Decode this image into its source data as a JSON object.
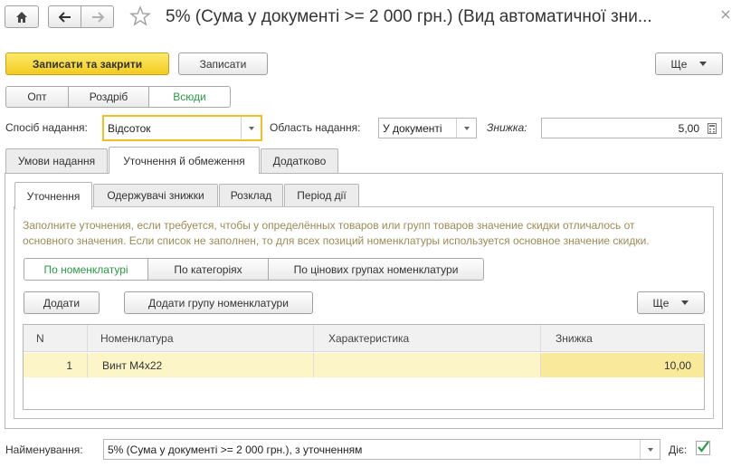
{
  "window": {
    "title": "5% (Сума у документі >= 2 000 грн.) (Вид автоматичної зни..."
  },
  "toolbar": {
    "save_close_label": "Записати та закрити",
    "save_label": "Записати",
    "more_label": "Ще"
  },
  "mode_segments": [
    {
      "label": "Опт",
      "selected": false
    },
    {
      "label": "Роздріб",
      "selected": false
    },
    {
      "label": "Всюди",
      "selected": true
    }
  ],
  "form": {
    "method_label": "Спосіб надання:",
    "method_value": "Відсоток",
    "area_label": "Область надання:",
    "area_value": "У документі",
    "discount_label": "Знижка:",
    "discount_value": "5,00"
  },
  "outer_tabs": [
    {
      "label": "Умови надання",
      "active": false
    },
    {
      "label": "Уточнення й обмеження",
      "active": true
    },
    {
      "label": "Додатково",
      "active": false
    }
  ],
  "inner_tabs": [
    {
      "label": "Уточнення",
      "active": true
    },
    {
      "label": "Одержувачі знижки",
      "active": false
    },
    {
      "label": "Розклад",
      "active": false
    },
    {
      "label": "Період дії",
      "active": false
    }
  ],
  "hint": {
    "line1": "Заполните уточнения, если требуется, чтобы у определённых товаров или групп товаров значение скидки отличалось от",
    "line2": "основного значения. Если список не заполнен, то для всех позиций номенклатуры используется основное значение скидки."
  },
  "filter_segments": [
    {
      "label": "По номенклатурі",
      "selected": true
    },
    {
      "label": "По категоріях",
      "selected": false
    },
    {
      "label": "По цінових групах номенклатури",
      "selected": false
    }
  ],
  "table_toolbar": {
    "add_label": "Додати",
    "add_group_label": "Додати групу номенклатури",
    "more_label": "Ще"
  },
  "table": {
    "columns": [
      "N",
      "Номенклатура",
      "Характеристика",
      "Знижка"
    ],
    "rows": [
      {
        "n": "1",
        "item": "Винт М4х22",
        "characteristic": "",
        "discount": "10,00"
      }
    ]
  },
  "footer": {
    "name_label": "Найменування:",
    "name_value": "5% (Сума у документі >= 2 000 грн.), з уточненням",
    "active_label": "Діє:",
    "active_checked": true
  },
  "colors": {
    "primary_button": "#f2cb20",
    "selected_row": "#fbf5c8",
    "selected_cell": "#f8ea9a",
    "accent_green": "#2b9a45",
    "hint_text": "#9b8b57",
    "focus_border": "#f0c020"
  }
}
